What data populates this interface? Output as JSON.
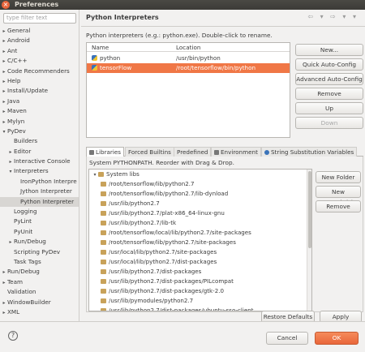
{
  "window": {
    "title": "Preferences",
    "close_glyph": "×"
  },
  "sidebar": {
    "filter_placeholder": "type filter text",
    "items": [
      {
        "label": "General",
        "indent": 0,
        "twisty": "▸"
      },
      {
        "label": "Android",
        "indent": 0,
        "twisty": "▸"
      },
      {
        "label": "Ant",
        "indent": 0,
        "twisty": "▸"
      },
      {
        "label": "C/C++",
        "indent": 0,
        "twisty": "▸"
      },
      {
        "label": "Code Recommenders",
        "indent": 0,
        "twisty": "▸"
      },
      {
        "label": "Help",
        "indent": 0,
        "twisty": "▸"
      },
      {
        "label": "Install/Update",
        "indent": 0,
        "twisty": "▸"
      },
      {
        "label": "Java",
        "indent": 0,
        "twisty": "▸"
      },
      {
        "label": "Maven",
        "indent": 0,
        "twisty": "▸"
      },
      {
        "label": "Mylyn",
        "indent": 0,
        "twisty": "▸"
      },
      {
        "label": "PyDev",
        "indent": 0,
        "twisty": "▾"
      },
      {
        "label": "Builders",
        "indent": 1,
        "twisty": ""
      },
      {
        "label": "Editor",
        "indent": 1,
        "twisty": "▸"
      },
      {
        "label": "Interactive Console",
        "indent": 1,
        "twisty": "▸"
      },
      {
        "label": "Interpreters",
        "indent": 1,
        "twisty": "▾"
      },
      {
        "label": "IronPython Interpre",
        "indent": 2,
        "twisty": ""
      },
      {
        "label": "Jython Interpreter",
        "indent": 2,
        "twisty": ""
      },
      {
        "label": "Python Interpreter",
        "indent": 2,
        "twisty": "",
        "selected": true
      },
      {
        "label": "Logging",
        "indent": 1,
        "twisty": ""
      },
      {
        "label": "PyLint",
        "indent": 1,
        "twisty": ""
      },
      {
        "label": "PyUnit",
        "indent": 1,
        "twisty": ""
      },
      {
        "label": "Run/Debug",
        "indent": 1,
        "twisty": "▸"
      },
      {
        "label": "Scripting PyDev",
        "indent": 1,
        "twisty": ""
      },
      {
        "label": "Task Tags",
        "indent": 1,
        "twisty": ""
      },
      {
        "label": "Run/Debug",
        "indent": 0,
        "twisty": "▸"
      },
      {
        "label": "Team",
        "indent": 0,
        "twisty": "▸"
      },
      {
        "label": "Validation",
        "indent": 0,
        "twisty": ""
      },
      {
        "label": "WindowBuilder",
        "indent": 0,
        "twisty": "▸"
      },
      {
        "label": "XML",
        "indent": 0,
        "twisty": "▸"
      }
    ]
  },
  "page": {
    "title": "Python Interpreters",
    "nav_arrows": "⇦ ▾ ⇨ ▾ ▾",
    "description": "Python interpreters (e.g.: python.exe).  Double-click to rename.",
    "table": {
      "headers": [
        "Name",
        "Location"
      ],
      "rows": [
        {
          "name": "python",
          "location": "/usr/bin/python",
          "selected": false
        },
        {
          "name": "tensorFlow",
          "location": "/root/tensorflow/bin/python",
          "selected": true
        }
      ]
    },
    "buttons": {
      "new": "New...",
      "quick": "Quick Auto-Config",
      "advanced": "Advanced Auto-Config",
      "remove": "Remove",
      "up": "Up",
      "down": "Down"
    },
    "tabs": [
      "Libraries",
      "Forced Builtins",
      "Predefined",
      "Environment",
      "String Substitution Variables"
    ],
    "libraries": {
      "description": "System PYTHONPATH.  Reorder with Drag & Drop.",
      "root": "System libs",
      "paths": [
        "/root/tensorflow/lib/python2.7",
        "/root/tensorflow/lib/python2.7/lib-dynload",
        "/usr/lib/python2.7",
        "/usr/lib/python2.7/plat-x86_64-linux-gnu",
        "/usr/lib/python2.7/lib-tk",
        "/root/tensorflow/local/lib/python2.7/site-packages",
        "/root/tensorflow/lib/python2.7/site-packages",
        "/usr/local/lib/python2.7/site-packages",
        "/usr/local/lib/python2.7/dist-packages",
        "/usr/lib/python2.7/dist-packages",
        "/usr/lib/python2.7/dist-packages/PILcompat",
        "/usr/lib/python2.7/dist-packages/gtk-2.0",
        "/usr/lib/pymodules/python2.7",
        "/usr/lib/python2.7/dist-packages/ubuntu-sso-client"
      ],
      "buttons": {
        "new_folder": "New Folder",
        "new_egg": "New Egg/Zip(s)",
        "remove": "Remove"
      }
    },
    "restore_defaults": "Restore Defaults",
    "apply": "Apply"
  },
  "footer": {
    "help_glyph": "?",
    "cancel": "Cancel",
    "ok": "OK"
  },
  "colors": {
    "accent": "#f07746",
    "title_bar": "#3c3b37"
  }
}
